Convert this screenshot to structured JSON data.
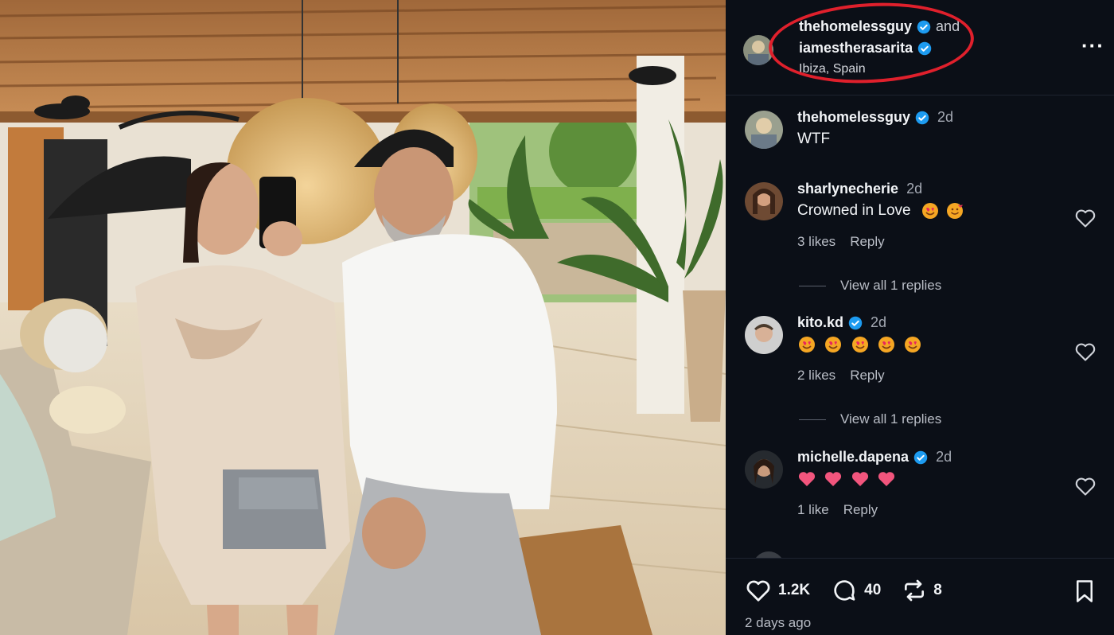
{
  "header": {
    "user1": "thehomelessguy",
    "and_text": "and",
    "user2": "iamestherasarita",
    "location": "Ibiza, Spain",
    "more_label": "···"
  },
  "comments": [
    {
      "user": "thehomelessguy",
      "verified": true,
      "time": "2d",
      "text": "WTF"
    },
    {
      "user": "sharlynecherie",
      "verified": false,
      "time": "2d",
      "text": "Crowned in Love",
      "likes": "3 likes",
      "reply": "Reply",
      "view_replies": "View all 1 replies"
    },
    {
      "user": "kito.kd",
      "verified": true,
      "time": "2d",
      "text": "",
      "likes": "2 likes",
      "reply": "Reply",
      "view_replies": "View all 1 replies"
    },
    {
      "user": "michelle.dapena",
      "verified": true,
      "time": "2d",
      "text": "",
      "likes": "1 like",
      "reply": "Reply"
    }
  ],
  "footer": {
    "likes_count": "1.2K",
    "comments_count": "40",
    "reposts_count": "8",
    "time_ago": "2 days ago"
  },
  "colors": {
    "background": "#0b0f17",
    "verified": "#1d9bf0",
    "annotation": "#e0202c"
  },
  "icons": [
    "verified-badge-icon",
    "more-icon",
    "heart-icon",
    "comment-icon",
    "repost-icon",
    "bookmark-icon",
    "heart-eyes-emoji",
    "smiling-hearts-emoji",
    "pink-heart-emoji"
  ]
}
